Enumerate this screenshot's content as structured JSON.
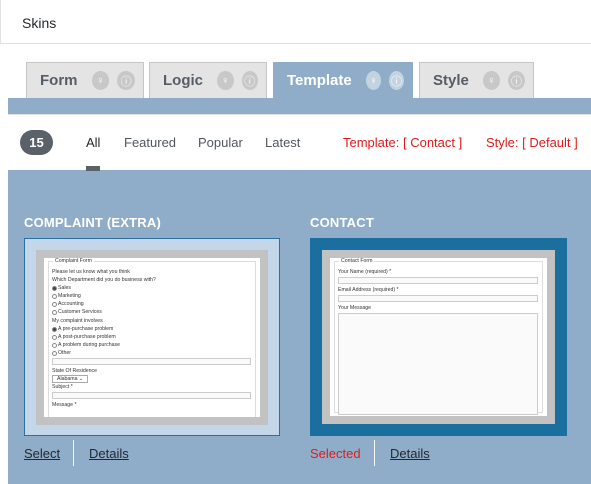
{
  "panel": {
    "title": "Skins"
  },
  "tabs": [
    {
      "label": "Form",
      "active": false
    },
    {
      "label": "Logic",
      "active": false
    },
    {
      "label": "Template",
      "active": true
    },
    {
      "label": "Style",
      "active": false
    }
  ],
  "filters": {
    "count": "15",
    "items": [
      "All",
      "Featured",
      "Popular",
      "Latest"
    ],
    "active": "All"
  },
  "current": {
    "template_text": "Template: [ Contact ]",
    "style_text": "Style: [ Default ]"
  },
  "cards": [
    {
      "title": "COMPLAINT (EXTRA)",
      "preview": {
        "legend": "Complaint Form",
        "intro": "Please let us know what you think",
        "q1": "Which Department did you do business with?",
        "q1_options": [
          "Sales",
          "Marketing",
          "Accounting",
          "Customer Services"
        ],
        "q2": "My complaint involves",
        "q2_options": [
          "A pre-purchase problem",
          "A post-purchase problem",
          "A problem during purchase",
          "Other"
        ],
        "state_label": "State Of Residence",
        "state_value": "Alabama",
        "subject_label": "Subject *",
        "message_label": "Message *"
      },
      "select_label": "Select",
      "details_label": "Details"
    },
    {
      "title": "CONTACT",
      "preview": {
        "legend": "Contact Form",
        "name_label": "Your Name (required) *",
        "email_label": "Email Address (required) *",
        "message_label": "Your Message"
      },
      "select_label": "Selected",
      "details_label": "Details"
    }
  ],
  "colors": {
    "accent_bg": "#8fadc9",
    "selected_border": "#1a6f9e",
    "meta_red": "#e01b1b"
  }
}
